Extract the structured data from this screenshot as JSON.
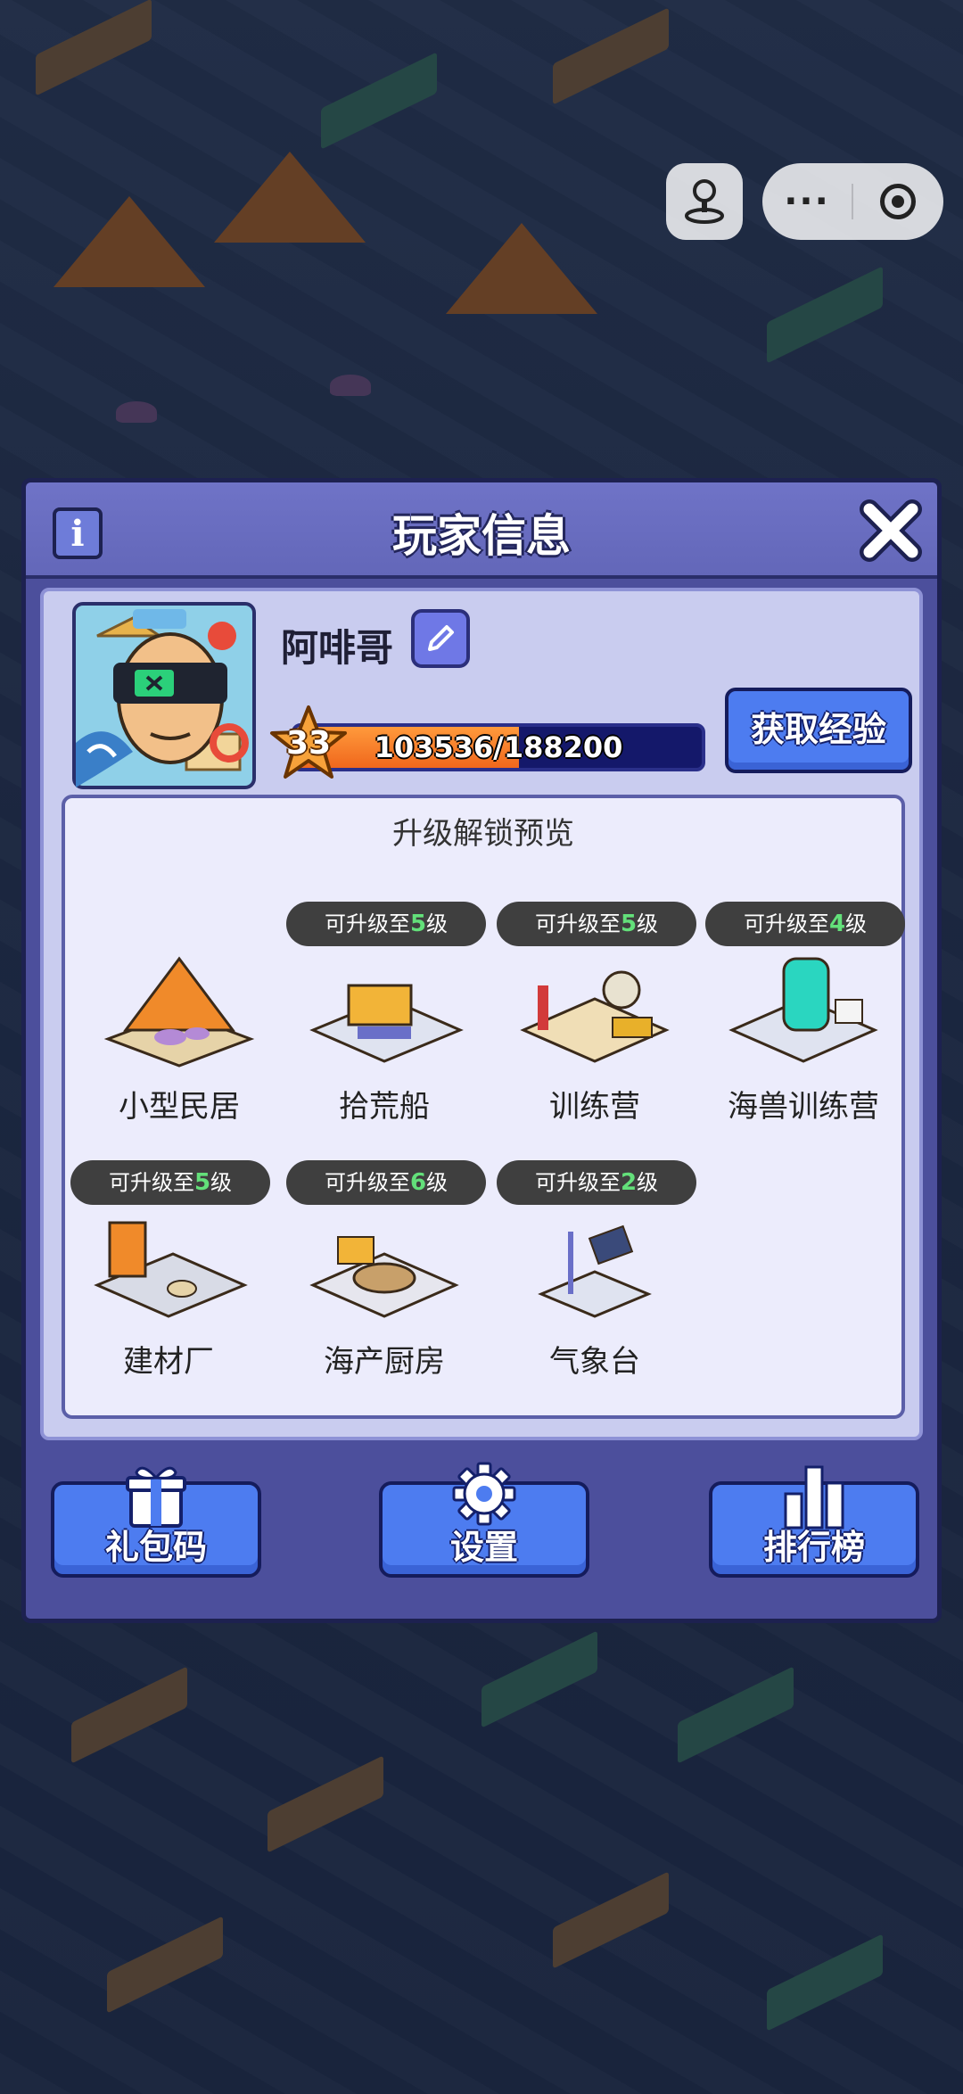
{
  "dialog": {
    "title": "玩家信息",
    "info_icon": "info-icon",
    "close_icon": "close-x-icon"
  },
  "player": {
    "name": "阿啡哥",
    "level": "33",
    "xp_text": "103536/188200",
    "xp_progress": 0.5501,
    "get_xp_label": "获取经验"
  },
  "preview": {
    "title": "升级解锁预览",
    "buildings": [
      {
        "name": "小型民居",
        "badge": null
      },
      {
        "name": "拾荒船",
        "badge": {
          "prefix": "可升级至",
          "level": "5",
          "suffix": "级"
        }
      },
      {
        "name": "训练营",
        "badge": {
          "prefix": "可升级至",
          "level": "5",
          "suffix": "级"
        }
      },
      {
        "name": "海兽训练营",
        "badge": {
          "prefix": "可升级至",
          "level": "4",
          "suffix": "级"
        }
      },
      {
        "name": "建材厂",
        "badge": {
          "prefix": "可升级至",
          "level": "5",
          "suffix": "级"
        }
      },
      {
        "name": "海产厨房",
        "badge": {
          "prefix": "可升级至",
          "level": "6",
          "suffix": "级"
        }
      },
      {
        "name": "气象台",
        "badge": {
          "prefix": "可升级至",
          "level": "2",
          "suffix": "级"
        }
      }
    ]
  },
  "bottom_buttons": [
    {
      "label": "礼包码",
      "icon": "gift-icon"
    },
    {
      "label": "设置",
      "icon": "gear-icon"
    },
    {
      "label": "排行榜",
      "icon": "bar-chart-icon"
    }
  ],
  "colors": {
    "dialog_bg": "#4c4f9c",
    "header_bg": "#6f73c7",
    "button_blue": "#4d7cf0",
    "xp_fill": "#f0671c",
    "badge_level": "#63e07a"
  }
}
